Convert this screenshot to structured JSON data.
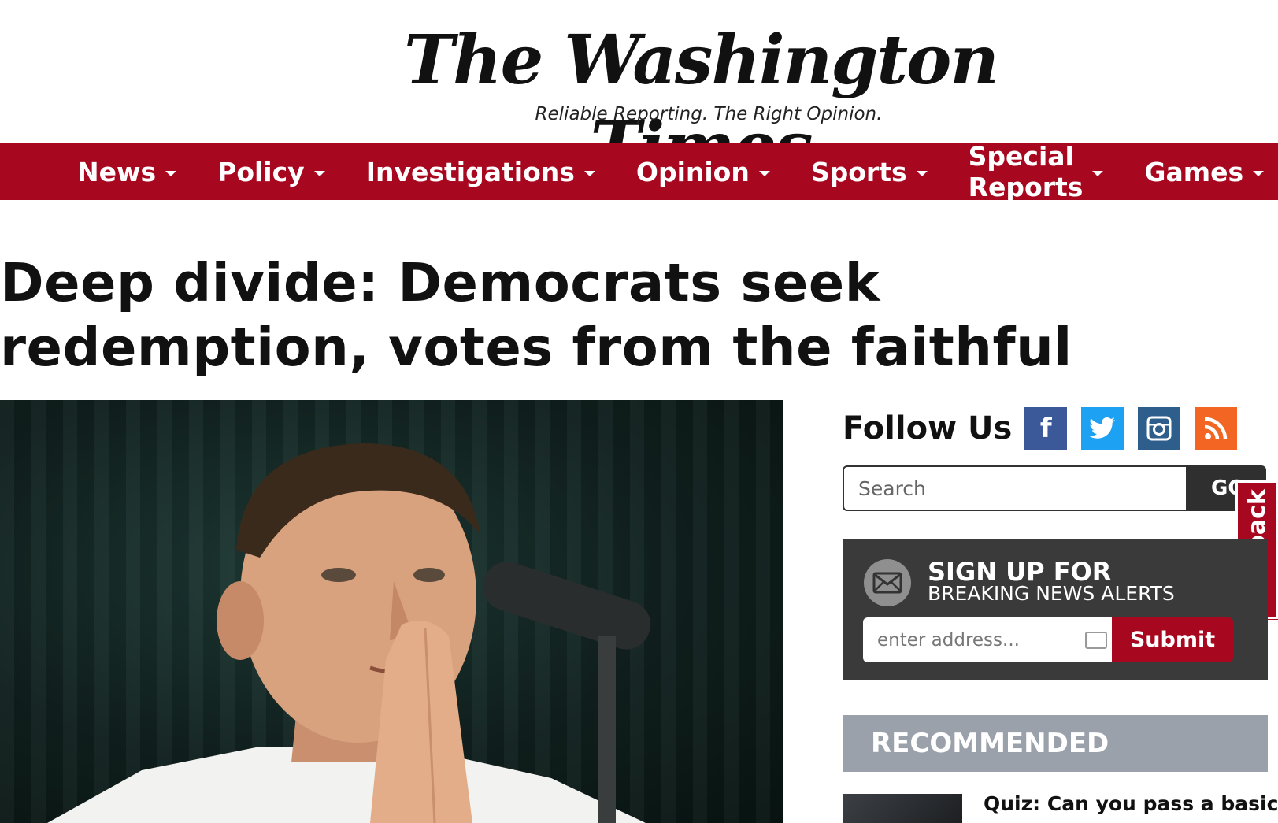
{
  "masthead": {
    "logo": "The Washington Times",
    "tagline": "Reliable Reporting. The Right Opinion."
  },
  "nav": {
    "items": [
      {
        "label": "News"
      },
      {
        "label": "Policy"
      },
      {
        "label": "Investigations"
      },
      {
        "label": "Opinion"
      },
      {
        "label": "Sports"
      },
      {
        "label": "Special Reports"
      },
      {
        "label": "Games"
      }
    ]
  },
  "article": {
    "headline": "Deep divide: Democrats seek redemption, votes from the faithful"
  },
  "sidebar": {
    "follow_title": "Follow Us",
    "social": [
      {
        "name": "facebook-icon",
        "glyph": "f"
      },
      {
        "name": "twitter-icon",
        "glyph": "🐦"
      },
      {
        "name": "instagram-icon",
        "glyph": "◎"
      },
      {
        "name": "rss-icon",
        "glyph": "◔"
      }
    ],
    "search": {
      "placeholder": "Search",
      "button": "GO"
    },
    "signup": {
      "title": "SIGN UP FOR",
      "subtitle": "BREAKING NEWS ALERTS",
      "email_placeholder": "enter address...",
      "submit": "Submit"
    },
    "feedback": "feedback",
    "recommended": {
      "header": "RECOMMENDED",
      "items": [
        {
          "title": "Quiz: Can you pass a basic"
        }
      ]
    }
  },
  "colors": {
    "brand_red": "#a8081f",
    "facebook": "#3b5998",
    "twitter": "#1da1f2",
    "instagram": "#2e5e8c",
    "rss": "#f26522"
  }
}
